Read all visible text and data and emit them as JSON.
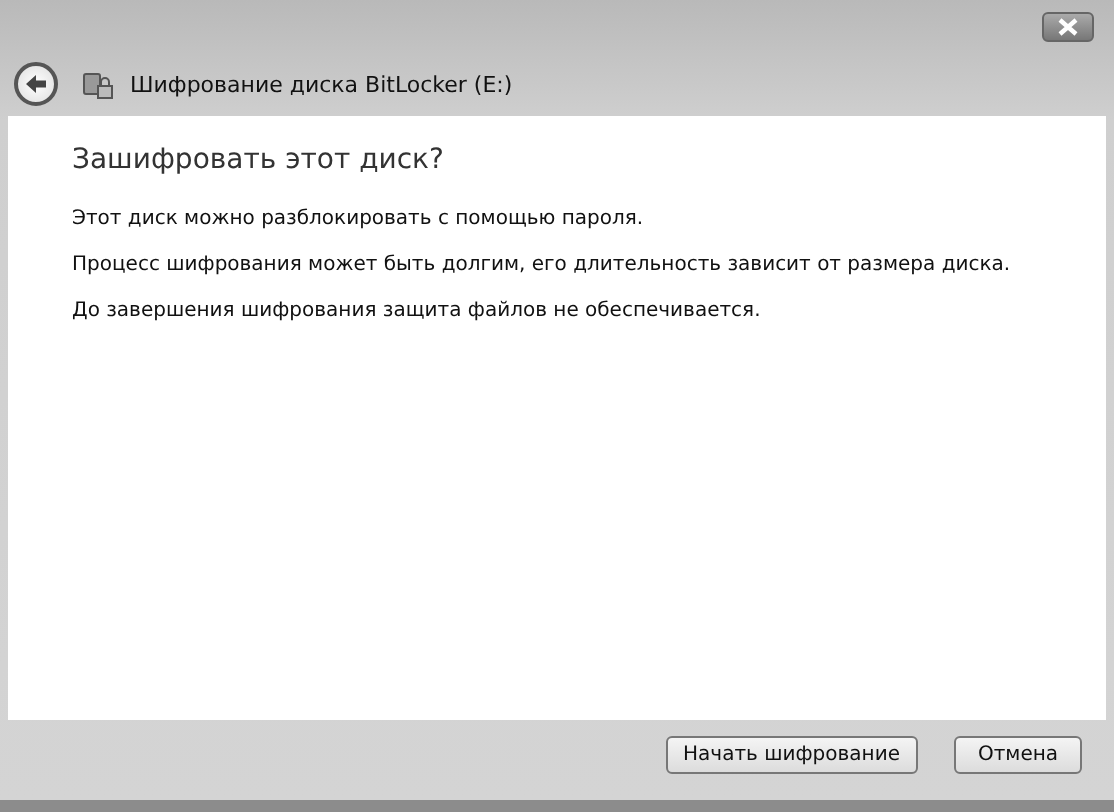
{
  "window": {
    "title": "Шифрование диска BitLocker (E:)"
  },
  "heading": "Зашифровать этот диск?",
  "paragraphs": [
    "Этот диск можно разблокировать с помощью пароля.",
    "Процесс шифрования может быть долгим, его длительность зависит от размера диска.",
    "До завершения шифрования защита файлов не обеспечивается."
  ],
  "buttons": [
    {
      "label": "Начать шифрование",
      "kind": "primary"
    },
    {
      "label": "Отмена",
      "kind": "cancel"
    }
  ]
}
